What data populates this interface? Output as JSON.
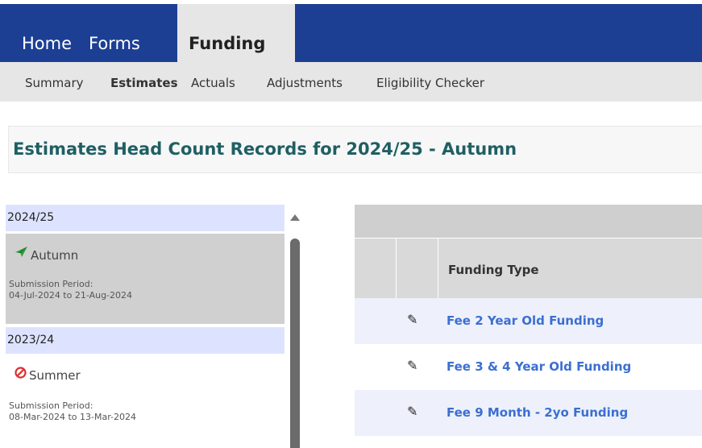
{
  "nav": {
    "home": "Home",
    "forms": "Forms",
    "funding": "Funding"
  },
  "subnav": {
    "summary": "Summary",
    "estimates": "Estimates",
    "actuals": "Actuals",
    "adjustments": "Adjustments",
    "eligibility": "Eligibility Checker"
  },
  "page_title": "Estimates Head Count Records for 2024/25 - Autumn",
  "periods": {
    "year_2024": "2024/25",
    "autumn": {
      "name": "Autumn",
      "icon": "plane-icon",
      "status_color": "#2e9e3a",
      "label": "Submission Period:",
      "dates": "04-Jul-2024 to 21-Aug-2024"
    },
    "year_2023": "2023/24",
    "summer": {
      "name": "Summer",
      "icon": "no-entry-icon",
      "status_color": "#e03030",
      "label": "Submission Period:",
      "dates": "08-Mar-2024 to 13-Mar-2024"
    }
  },
  "grid": {
    "header": "Funding Type",
    "rows": [
      {
        "label": "Fee 2 Year Old Funding"
      },
      {
        "label": "Fee 3 & 4 Year Old Funding"
      },
      {
        "label": "Fee 9 Month - 2yo Funding"
      }
    ]
  },
  "colors": {
    "nav_bg": "#1c3f94",
    "title": "#1f5f63",
    "link": "#3b6fd1",
    "year_header": "#dde3ff"
  }
}
